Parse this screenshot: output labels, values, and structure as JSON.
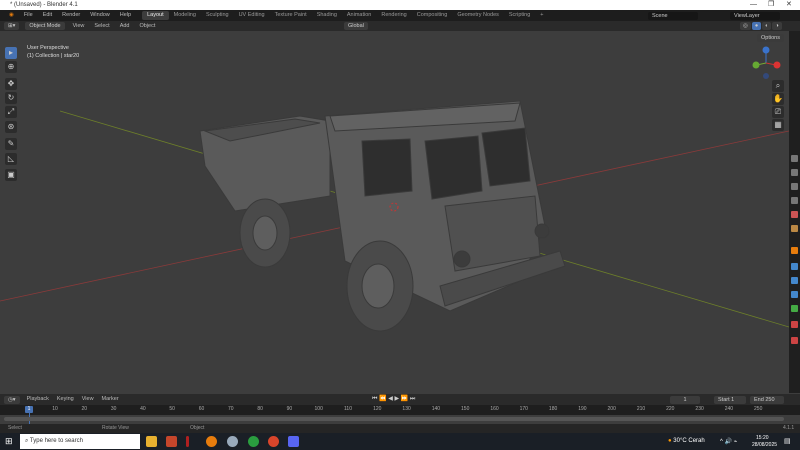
{
  "window": {
    "title": "* (Unsaved) - Blender 4.1",
    "min": "—",
    "max": "❐",
    "close": "✕"
  },
  "menu": [
    "File",
    "Edit",
    "Render",
    "Window",
    "Help"
  ],
  "workspaces": [
    "Layout",
    "Modeling",
    "Sculpting",
    "UV Editing",
    "Texture Paint",
    "Shading",
    "Animation",
    "Rendering",
    "Compositing",
    "Geometry Nodes",
    "Scripting"
  ],
  "add_workspace": "+",
  "scene": "Scene",
  "view_layer": "ViewLayer",
  "header": {
    "mode": "Object Mode",
    "items": [
      "View",
      "Select",
      "Add",
      "Object"
    ],
    "orientation": "Global",
    "options": "Options"
  },
  "viewport": {
    "perspective": "User Perspective",
    "collection": "(1) Collection | star20"
  },
  "gizmo": {
    "x": "X",
    "y": "Y",
    "z": "Z"
  },
  "timeline": {
    "menus": [
      "Playback",
      "Keying",
      "View",
      "Marker"
    ],
    "current_frame": "1",
    "start_label": "Start",
    "start": "1",
    "end_label": "End",
    "end": "250",
    "ticks": [
      "10",
      "20",
      "30",
      "40",
      "50",
      "60",
      "70",
      "80",
      "90",
      "100",
      "110",
      "120",
      "130",
      "140",
      "150",
      "160",
      "170",
      "180",
      "190",
      "200",
      "210",
      "220",
      "230",
      "240",
      "250"
    ],
    "cursor": "1"
  },
  "status": {
    "select": "Select",
    "rotate": "Rotate View",
    "object": "Object",
    "version": "4.1.1"
  },
  "taskbar": {
    "search_placeholder": "Type here to search",
    "weather": "30°C  Cerah",
    "time": "15:20",
    "date": "28/08/2025"
  }
}
